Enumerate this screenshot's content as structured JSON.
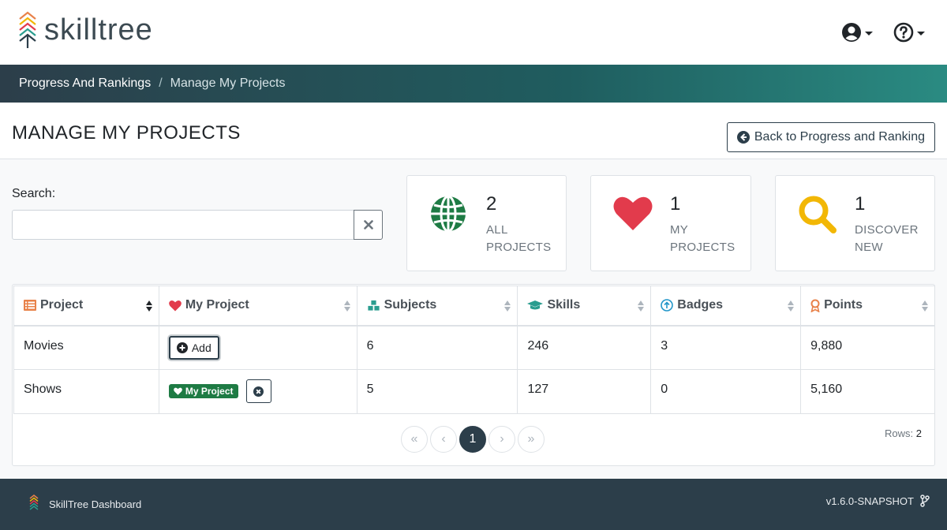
{
  "header": {
    "logo_text": "skilltree"
  },
  "breadcrumb": {
    "items": [
      {
        "label": "Progress And Rankings"
      },
      {
        "label": "Manage My Projects"
      }
    ],
    "separator": "/"
  },
  "page": {
    "title": "MANAGE MY PROJECTS",
    "back_button_label": "Back to Progress and Ranking"
  },
  "search": {
    "label": "Search:",
    "value": "",
    "placeholder": ""
  },
  "stats": [
    {
      "count": "2",
      "label_line1": "ALL",
      "label_line2": "PROJECTS",
      "icon": "globe-icon",
      "color": "#1e7b44"
    },
    {
      "count": "1",
      "label_line1": "MY",
      "label_line2": "PROJECTS",
      "icon": "heart-icon",
      "color": "#e23b4c"
    },
    {
      "count": "1",
      "label_line1": "DISCOVER",
      "label_line2": "NEW",
      "icon": "search-icon",
      "color": "#f2b705"
    }
  ],
  "table": {
    "columns": [
      "Project",
      "My Project",
      "Subjects",
      "Skills",
      "Badges",
      "Points"
    ],
    "rows": [
      {
        "project": "Movies",
        "subjects": "6",
        "skills": "246",
        "badges": "3",
        "points": "9,880",
        "my_project": false,
        "add_label": "Add"
      },
      {
        "project": "Shows",
        "subjects": "5",
        "skills": "127",
        "badges": "0",
        "points": "5,160",
        "my_project": true,
        "badge_label": "My Project"
      }
    ]
  },
  "pagination": {
    "first": "«",
    "prev": "‹",
    "current": "1",
    "next": "›",
    "last": "»",
    "rows_label": "Rows:",
    "rows_count": "2"
  },
  "footer": {
    "title": "SkillTree Dashboard",
    "version": "v1.6.0-SNAPSHOT"
  },
  "colors": {
    "primary": "#2c3e4a",
    "green": "#1e7b44",
    "red": "#e23b4c",
    "yellow": "#f2b705",
    "orange": "#e8824a",
    "teal": "#2a9d8f",
    "blue": "#2196c9"
  }
}
